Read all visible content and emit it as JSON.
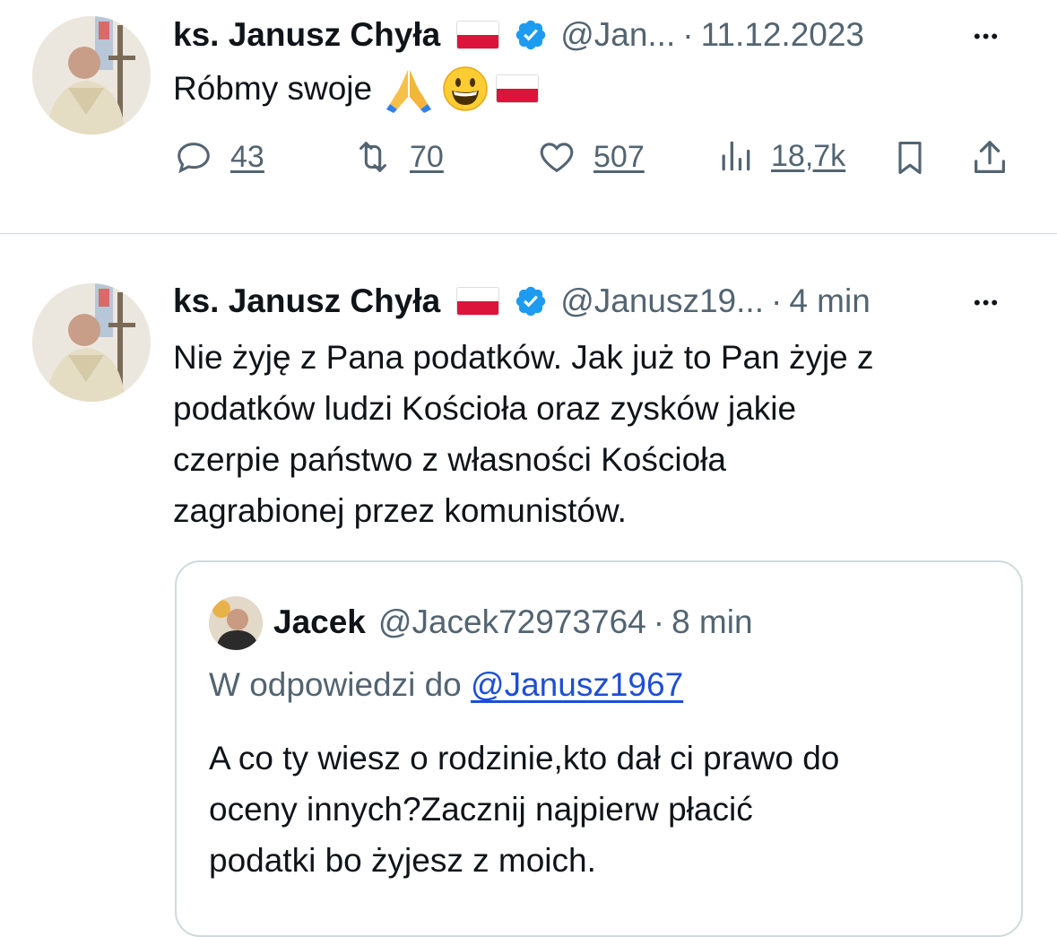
{
  "tweet1": {
    "name": "ks. Janusz Chyła",
    "handle": "@Jan...",
    "sep": "·",
    "time": "11.12.2023",
    "more": "•••",
    "text": "Róbmy swoje",
    "emojis": [
      "folded-hands",
      "grinning-face",
      "poland-flag"
    ],
    "actions": {
      "replies": "43",
      "retweets": "70",
      "likes": "507",
      "views": "18,7k"
    }
  },
  "tweet2": {
    "name": "ks. Janusz Chyła",
    "handle": "@Janusz19...",
    "sep": "·",
    "time": "4 min",
    "more": "•••",
    "lines": [
      "Nie żyję z Pana podatków. Jak już to Pan żyje z",
      "podatków ludzi Kościoła oraz zysków jakie",
      "czerpie państwo z własności Kościoła",
      "zagrabionej przez komunistów."
    ]
  },
  "quote": {
    "name": "Jacek",
    "handle": "@Jacek72973764",
    "sep": "·",
    "time": "8 min",
    "reply_prefix": "W odpowiedzi do",
    "reply_handle": "@Janusz1967",
    "lines": [
      "A co ty wiesz o rodzinie,kto dał ci prawo do",
      "oceny innych?Zacznij najpierw płacić",
      "podatki bo żyjesz z moich."
    ]
  },
  "colors": {
    "text": "#0f1419",
    "secondary": "#536471",
    "verified": "#1d9bf0",
    "link": "#1d4ed8",
    "divider": "#cfd9de",
    "flag_red": "#dc143c"
  }
}
